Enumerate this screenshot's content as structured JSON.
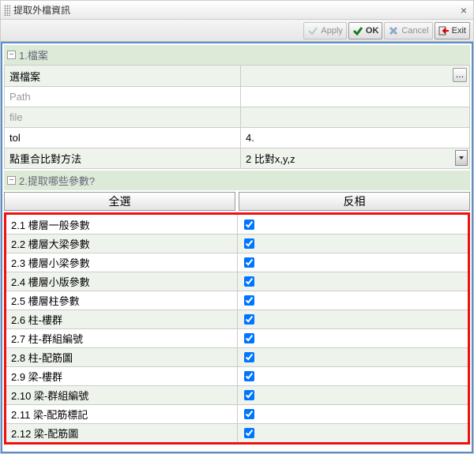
{
  "window": {
    "title": "提取外檔資訊"
  },
  "toolbar": {
    "apply": "Apply",
    "ok": "OK",
    "cancel": "Cancel",
    "exit": "Exit"
  },
  "section1": {
    "header": "1.檔案",
    "rows": {
      "select_file_label": "選檔案",
      "select_file_value": "",
      "path_label": "Path",
      "path_value": "",
      "file_label": "file",
      "file_value": "",
      "tol_label": "tol",
      "tol_value": "4.",
      "method_label": "點重合比對方法",
      "method_value": "2 比對x,y,z"
    }
  },
  "section2": {
    "header": "2.提取哪些參數?",
    "select_all": "全選",
    "invert": "反相",
    "params": [
      {
        "label": "2.1 樓層一般參數",
        "checked": true
      },
      {
        "label": "2.2 樓層大梁參數",
        "checked": true
      },
      {
        "label": "2.3 樓層小梁參數",
        "checked": true
      },
      {
        "label": "2.4 樓層小版參數",
        "checked": true
      },
      {
        "label": "2.5 樓層柱參數",
        "checked": true
      },
      {
        "label": "2.6 柱-樓群",
        "checked": true
      },
      {
        "label": "2.7 柱-群組編號",
        "checked": true
      },
      {
        "label": "2.8 柱-配筋圖",
        "checked": true
      },
      {
        "label": "2.9 梁-樓群",
        "checked": true
      },
      {
        "label": "2.10 梁-群組編號",
        "checked": true
      },
      {
        "label": "2.11 梁-配筋標記",
        "checked": true
      },
      {
        "label": "2.12 梁-配筋圖",
        "checked": true
      }
    ]
  }
}
